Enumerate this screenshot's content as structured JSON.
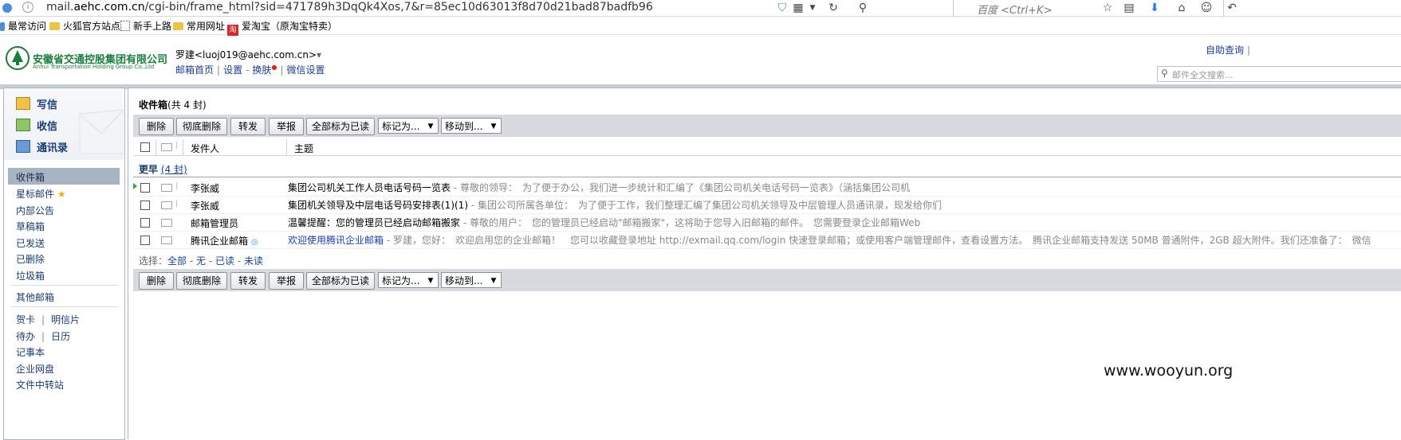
{
  "browser": {
    "url_prefix": "mail.",
    "url_domain": "aehc.com.cn",
    "url_path": "/cgi-bin/frame_html?sid=471789h3DqQk4Xos,7&r=85ec10d63013f8d70d21bad87badfb96",
    "search_placeholder": "百度 <Ctrl+K>"
  },
  "bookmarks": [
    {
      "label": "最常访问"
    },
    {
      "label": "火狐官方站点"
    },
    {
      "label": "新手上路"
    },
    {
      "label": "常用网址"
    },
    {
      "label": "爱淘宝（原淘宝特卖）",
      "badge": "淘"
    }
  ],
  "header": {
    "logo_name_cn": "安徽省交通控股集团有限公司",
    "logo_name_en": "Anhui Transportation Holding Group Co.,Ltd",
    "user": "罗建<luoj019@aehc.com.cn>",
    "user_arrow": "▾",
    "links": [
      "邮箱首页",
      "设置",
      "换肤",
      "微信设置"
    ],
    "self_query": "自助查询",
    "search_placeholder": "邮件全文搜索..."
  },
  "sidebar": {
    "actions": [
      "写信",
      "收信",
      "通讯录"
    ],
    "folders": [
      "收件箱",
      "星标邮件",
      "内部公告",
      "草稿箱",
      "已发送",
      "已删除",
      "垃圾箱"
    ],
    "star": "★",
    "other_mailboxes": "其他邮箱",
    "apps_row1": [
      "贺卡",
      "明信片"
    ],
    "apps_row2": [
      "待办",
      "日历"
    ],
    "apps": [
      "记事本",
      "企业网盘",
      "文件中转站"
    ]
  },
  "main": {
    "title": "收件箱",
    "title_count": "(共 4 封)",
    "toolbar": {
      "delete": "删除",
      "delete_permanent": "彻底删除",
      "forward": "转发",
      "report": "举报",
      "mark_all_read": "全部标为已读",
      "mark_as": "标记为...",
      "move_to": "移动到..."
    },
    "columns": {
      "sender": "发件人",
      "subject": "主题"
    },
    "group": {
      "label": "更早",
      "count": "(4 封)"
    },
    "emails": [
      {
        "sender": "李张威",
        "subject": "集团公司机关工作人员电话号码一览表",
        "preview": " - 尊敬的领导：　为了便于办公，我们进一步统计和汇编了《集团公司机关电话号码一览表》（涵括集团公司机"
      },
      {
        "sender": "李张威",
        "subject": "集团机关领导及中层电话号码安排表(1)(1)",
        "preview": " - 集团公司所属各单位：　为了便于工作，我们整理汇编了集团公司机关领导及中层管理人员通讯录，现发给你们"
      },
      {
        "sender": "邮箱管理员",
        "subject": "温馨提醒：您的管理员已经启动邮箱搬家",
        "preview": " - 尊敬的用户：　您的管理员已经启动\"邮箱搬家\"，这将助于您导入旧邮箱的邮件。　您需要登录企业邮箱Web"
      },
      {
        "sender": "腾讯企业邮箱",
        "subject": "欢迎使用腾讯企业邮箱",
        "preview": " - 罗建，您好：　欢迎启用您的企业邮箱！　您可以收藏登录地址 http://exmail.qq.com/login 快速登录邮箱；或使用客户端管理邮件，查看设置方法。　腾讯企业邮箱支持发送 50MB 普通附件，2GB 超大附件。我们还准备了：　微信"
      }
    ],
    "select": {
      "label": "选择：",
      "all": "全部",
      "none": "无",
      "read": "已读",
      "unread": "未读"
    }
  },
  "watermark": "www.wooyun.org"
}
